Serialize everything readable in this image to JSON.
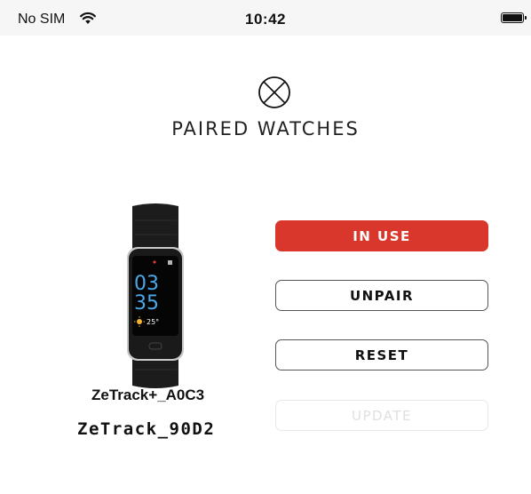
{
  "status_bar": {
    "carrier": "No SIM",
    "time": "10:42"
  },
  "header": {
    "title": "PAIRED WATCHES"
  },
  "watch": {
    "time_hours": "03",
    "time_minutes": "35",
    "temperature": "25°"
  },
  "devices": [
    {
      "name": "ZeTrack+_A0C3"
    },
    {
      "name": "ZeTrack_90D2"
    }
  ],
  "actions": {
    "in_use": "IN USE",
    "unpair": "UNPAIR",
    "reset": "RESET",
    "update": "UPDATE"
  },
  "colors": {
    "accent": "#d9372b",
    "disabled_text": "#e0e0e0"
  }
}
